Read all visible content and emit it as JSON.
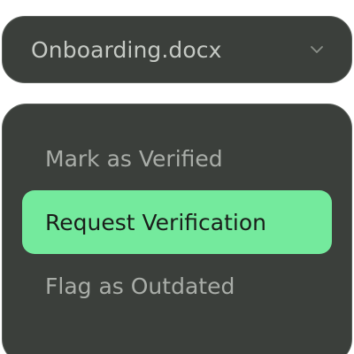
{
  "select": {
    "value": "Onboarding.docx",
    "icon": "chevron-down-icon"
  },
  "menu": {
    "items": [
      {
        "label": "Mark as Verified",
        "highlighted": false
      },
      {
        "label": "Request Verification",
        "highlighted": true
      },
      {
        "label": "Flag as Outdated",
        "highlighted": false
      }
    ]
  },
  "colors": {
    "surface": "#3b3f3b",
    "border": "#5b605b",
    "text": "#c5c9c4",
    "muted_text": "#a9ada8",
    "highlight": "#74ea9d",
    "highlight_text": "#1a1d1a"
  }
}
